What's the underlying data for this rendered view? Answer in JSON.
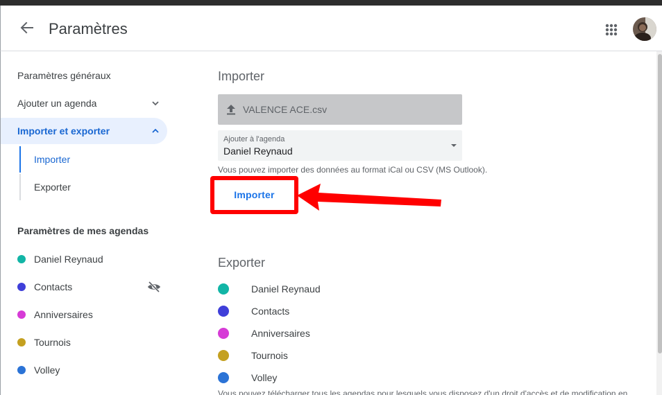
{
  "header": {
    "title": "Paramètres",
    "back_icon": "arrow-back-icon",
    "apps_icon": "apps-grid-icon"
  },
  "sidebar": {
    "items": [
      {
        "label": "Paramètres généraux"
      },
      {
        "label": "Ajouter un agenda"
      },
      {
        "label": "Importer et exporter"
      }
    ],
    "subitems": [
      {
        "label": "Importer"
      },
      {
        "label": "Exporter"
      }
    ],
    "section_header": "Paramètres de mes agendas",
    "calendars": [
      {
        "label": "Daniel Reynaud",
        "color": "#12b5a6"
      },
      {
        "label": "Contacts",
        "color": "#3f3fd9"
      },
      {
        "label": "Anniversaires",
        "color": "#d63bd6"
      },
      {
        "label": "Tournois",
        "color": "#c4a020"
      },
      {
        "label": "Volley",
        "color": "#2b73d6"
      }
    ]
  },
  "import": {
    "title": "Importer",
    "file_name": "VALENCE ACE.csv",
    "select_label": "Ajouter à l'agenda",
    "select_value": "Daniel Reynaud",
    "helper": "Vous pouvez importer des données au format iCal ou CSV (MS Outlook).",
    "button_label": "Importer"
  },
  "export": {
    "title": "Exporter",
    "calendars": [
      {
        "label": "Daniel Reynaud",
        "color": "#12b5a6"
      },
      {
        "label": "Contacts",
        "color": "#3f3fd9"
      },
      {
        "label": "Anniversaires",
        "color": "#d63bd6"
      },
      {
        "label": "Tournois",
        "color": "#c4a020"
      },
      {
        "label": "Volley",
        "color": "#2b73d6"
      }
    ],
    "helper": "Vous pouvez télécharger tous les agendas pour lesquels vous disposez d'un droit d'accès et de modification en"
  },
  "colors": {
    "accent": "#1a73e8",
    "highlight": "#ff0000"
  }
}
